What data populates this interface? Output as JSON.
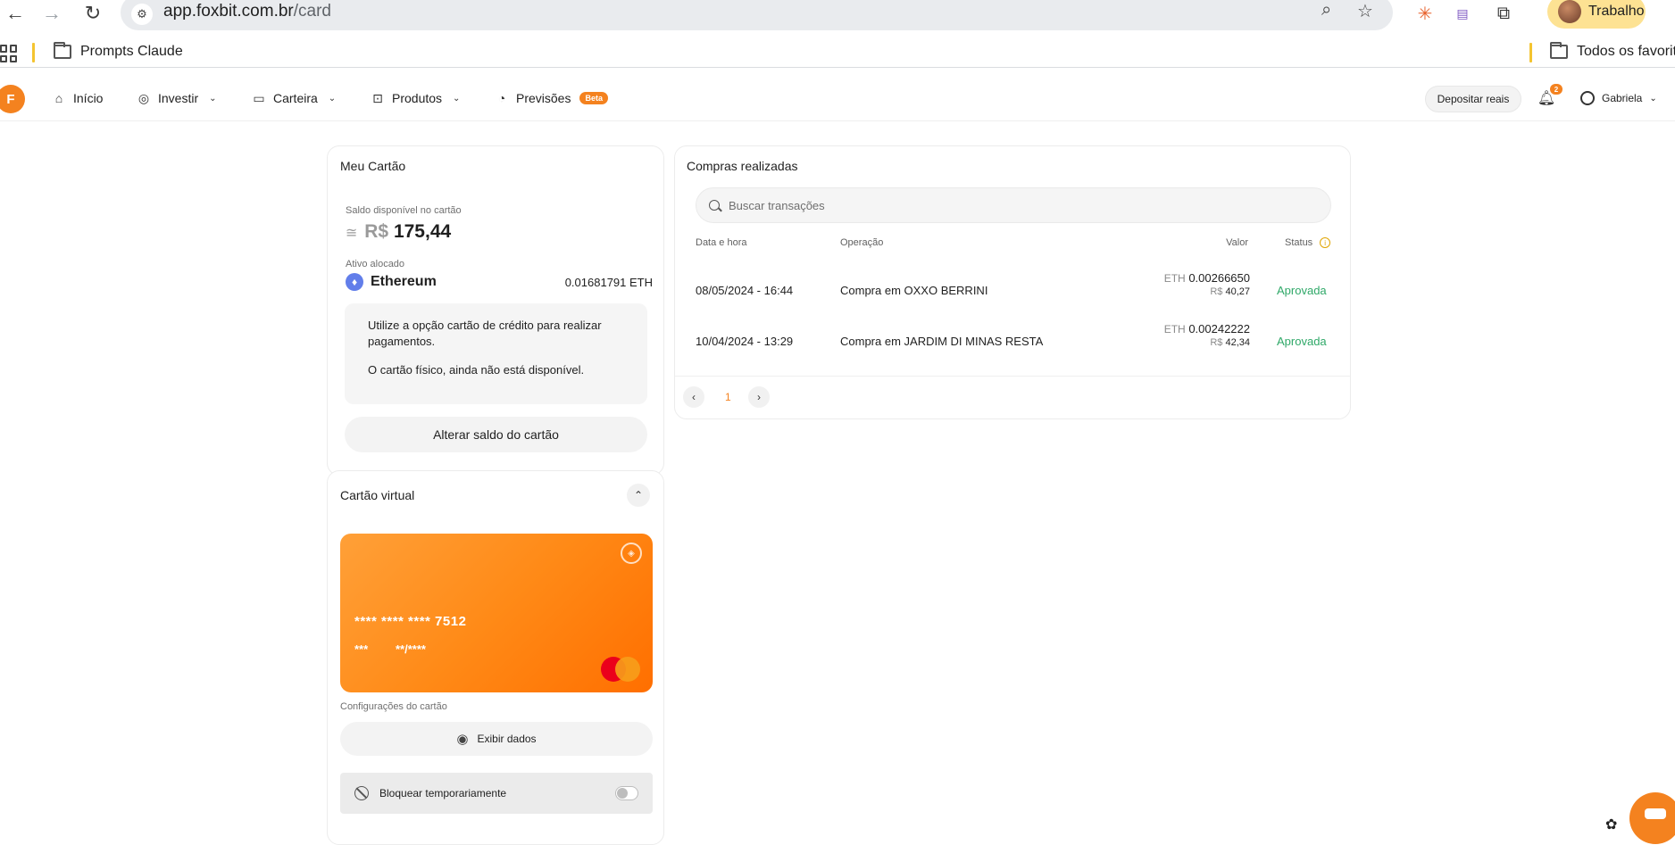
{
  "browser": {
    "url_host": "app.foxbit.com.br",
    "url_path": "/card",
    "profile_name": "Trabalho",
    "bookmarks": [
      {
        "label": "Prompts Claude"
      },
      {
        "label": "Todos os favoritos"
      }
    ]
  },
  "header": {
    "logo_text": "F",
    "menu": [
      {
        "label": "Início",
        "icon": "home-icon",
        "has_dropdown": false
      },
      {
        "label": "Investir",
        "icon": "investir-icon",
        "has_dropdown": true
      },
      {
        "label": "Carteira",
        "icon": "wallet-icon",
        "has_dropdown": true
      },
      {
        "label": "Produtos",
        "icon": "products-icon",
        "has_dropdown": true
      },
      {
        "label": "Previsões",
        "icon": "forecast-icon",
        "has_dropdown": false,
        "badge": "Beta"
      }
    ],
    "deposit_label": "Depositar reais",
    "notification_count": "2",
    "user_name": "Gabriela"
  },
  "my_card": {
    "title": "Meu Cartão",
    "balance_label": "Saldo disponível no cartão",
    "balance_approx": "≅",
    "balance_currency": "R$",
    "balance_value": "175,44",
    "asset_label": "Ativo alocado",
    "asset_name": "Ethereum",
    "asset_amount": "0.01681791 ETH",
    "info_lines": [
      "Utilize a opção cartão de crédito para realizar pagamentos.",
      "O cartão físico, ainda não está disponível."
    ],
    "change_balance_label": "Alterar saldo do cartão"
  },
  "virtual_card": {
    "title": "Cartão virtual",
    "card_number": "**** **** **** 7512",
    "cvv": "***",
    "expiry": "**/****",
    "settings_label": "Configurações do cartão",
    "show_data_label": "Exibir dados",
    "block_label": "Bloquear temporariamente",
    "block_enabled": false
  },
  "purchases": {
    "title": "Compras realizadas",
    "search_placeholder": "Buscar transações",
    "columns": {
      "date": "Data e hora",
      "operation": "Operação",
      "value": "Valor",
      "status": "Status"
    },
    "rows": [
      {
        "date": "08/05/2024 - 16:44",
        "operation": "Compra em OXXO BERRINI",
        "eth_symbol": "ETH",
        "eth_value": "0.00266650",
        "brl_symbol": "R$",
        "brl_value": "40,27",
        "status": "Aprovada"
      },
      {
        "date": "10/04/2024 - 13:29",
        "operation": "Compra em JARDIM DI MINAS RESTA",
        "eth_symbol": "ETH",
        "eth_value": "0.00242222",
        "brl_symbol": "R$",
        "brl_value": "42,34",
        "status": "Aprovada"
      }
    ],
    "current_page": "1"
  },
  "colors": {
    "brand": "#f4821f",
    "approved": "#2fa868",
    "ethereum": "#627eea"
  }
}
